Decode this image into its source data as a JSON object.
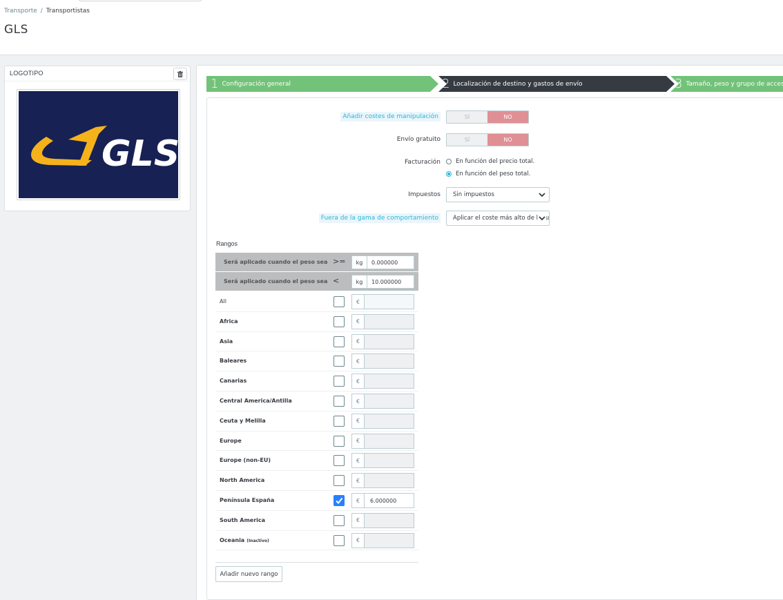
{
  "breadcrumb": {
    "parent": "Transporte",
    "separator": "/",
    "current": "Transportistas"
  },
  "page_title": "GLS",
  "logo_panel": {
    "title": "LOGOTIPO",
    "trash_icon": "trash-icon",
    "logo_text": "GLS",
    "logo_bg": "#172154",
    "logo_color": "#f5b21b"
  },
  "steps": [
    {
      "number": "1",
      "label": "Configuración general",
      "state": "done",
      "color": "#72c279"
    },
    {
      "number": "2",
      "label": "Localización de destino y gastos de envío",
      "state": "active",
      "color": "#363a41"
    },
    {
      "number": "3",
      "label": "Tamaño, peso y grupo de acceso",
      "state": "next",
      "color": "#72c279"
    }
  ],
  "form": {
    "handling": {
      "label": "Añadir costes de manipulación",
      "yes": "SÍ",
      "no": "NO",
      "value": "NO"
    },
    "free_shipping": {
      "label": "Envío gratuito",
      "yes": "SÍ",
      "no": "NO",
      "value": "NO"
    },
    "billing": {
      "label": "Facturación",
      "options": [
        "En función del precio total.",
        "En función del peso total."
      ],
      "selected_index": 1
    },
    "taxes": {
      "label": "Impuestos",
      "value": "Sin impuestos"
    },
    "out_of_range": {
      "label": "Fuera de la gama de comportamiento",
      "value": "Aplicar el coste más alto de la gama definida"
    }
  },
  "ranges": {
    "title": "Rangos",
    "header_rows": [
      {
        "text": "Será aplicado cuando el peso sea",
        "operator": ">=",
        "unit": "kg",
        "value": "0.000000"
      },
      {
        "text": "Será aplicado cuando el peso sea",
        "operator": "<",
        "unit": "kg",
        "value": "10.000000"
      }
    ],
    "currency": "€",
    "zones": [
      {
        "name": "All",
        "checked": false,
        "price": "",
        "tag": ""
      },
      {
        "name": "Africa",
        "checked": false,
        "price": "",
        "tag": ""
      },
      {
        "name": "Asia",
        "checked": false,
        "price": "",
        "tag": ""
      },
      {
        "name": "Baleares",
        "checked": false,
        "price": "",
        "tag": ""
      },
      {
        "name": "Canarias",
        "checked": false,
        "price": "",
        "tag": ""
      },
      {
        "name": "Central America/Antilla",
        "checked": false,
        "price": "",
        "tag": ""
      },
      {
        "name": "Ceuta y Melilla",
        "checked": false,
        "price": "",
        "tag": ""
      },
      {
        "name": "Europe",
        "checked": false,
        "price": "",
        "tag": ""
      },
      {
        "name": "Europe (non-EU)",
        "checked": false,
        "price": "",
        "tag": ""
      },
      {
        "name": "North America",
        "checked": false,
        "price": "",
        "tag": ""
      },
      {
        "name": "Península España",
        "checked": true,
        "price": "6.000000",
        "tag": ""
      },
      {
        "name": "South America",
        "checked": false,
        "price": "",
        "tag": ""
      },
      {
        "name": "Oceania",
        "checked": false,
        "price": "",
        "tag": "(Inactivo)"
      }
    ],
    "add_button": "Añadir nuevo rango"
  },
  "colors": {
    "accent": "#25b9d7",
    "switch_off": "#e08f95",
    "step_done": "#72c279",
    "step_active": "#363a41",
    "checkbox_on": "#2a7fff"
  }
}
